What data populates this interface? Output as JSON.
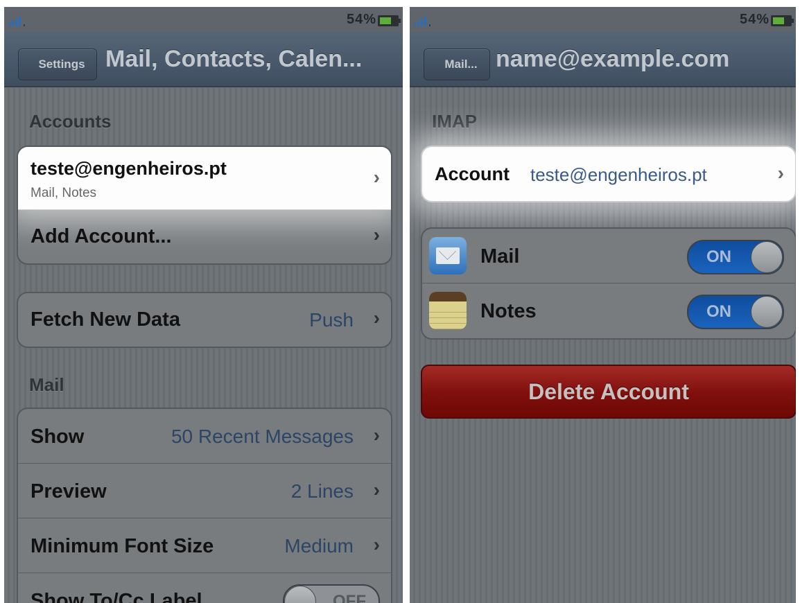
{
  "left": {
    "status": {
      "battery": "54%"
    },
    "nav": {
      "back": "Settings",
      "title": "Mail, Contacts, Calen..."
    },
    "accounts_header": "Accounts",
    "account": {
      "email": "teste@engenheiros.pt",
      "services": "Mail, Notes"
    },
    "add_account": "Add Account...",
    "fetch": {
      "label": "Fetch New Data",
      "value": "Push"
    },
    "mail_header": "Mail",
    "rows": [
      {
        "label": "Show",
        "value": "50 Recent Messages"
      },
      {
        "label": "Preview",
        "value": "2 Lines"
      },
      {
        "label": "Minimum Font Size",
        "value": "Medium"
      },
      {
        "label": "Show To/Cc Label",
        "value": "OFF"
      }
    ]
  },
  "right": {
    "status": {
      "battery": "54%"
    },
    "nav": {
      "back": "Mail...",
      "title": "name@example.com"
    },
    "imap_header": "IMAP",
    "account": {
      "label": "Account",
      "value": "teste@engenheiros.pt"
    },
    "services": [
      {
        "name": "Mail",
        "state": "ON",
        "icon": "mail-app-icon"
      },
      {
        "name": "Notes",
        "state": "ON",
        "icon": "notes-app-icon"
      }
    ],
    "delete": "Delete Account"
  },
  "colors": {
    "navbar": "#4b5a6c",
    "value_blue": "#2c4566",
    "toggle_on": "#1a5fb4",
    "delete_red": "#8b1512",
    "battery_green": "#5fae3c"
  }
}
